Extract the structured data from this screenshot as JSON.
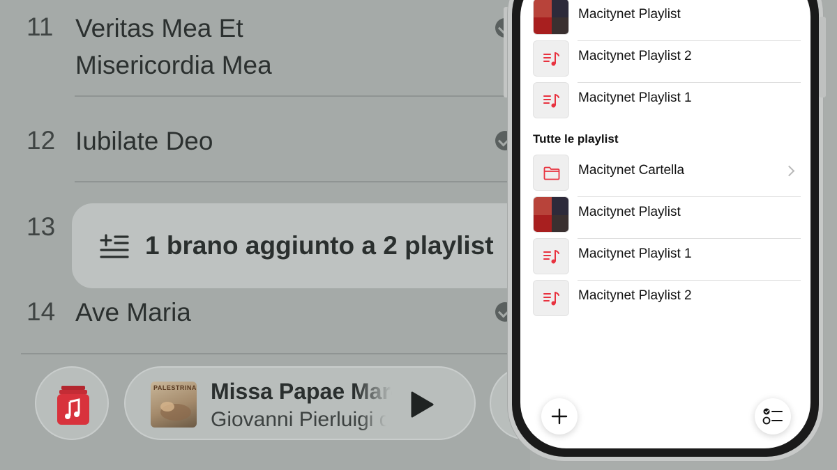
{
  "tracklist": {
    "items": [
      {
        "number": "11",
        "title_line1": "Veritas Mea Et",
        "title_line2": "Misericordia Mea"
      },
      {
        "number": "12",
        "title_line1": "Iubilate Deo"
      },
      {
        "number": "13"
      },
      {
        "number": "14",
        "title_line1": "Ave Maria"
      }
    ]
  },
  "toast": {
    "message": "1 brano aggiunto a 2 playlist",
    "icon": "add-to-list-icon"
  },
  "mini_player": {
    "app_icon": "music-app-icon",
    "artwork_label": "PALESTRINA",
    "song_title": "Missa Papae Marcelli",
    "artist": "Giovanni Pierluigi da Palestrina",
    "play_icon": "play-icon"
  },
  "phone": {
    "recent_playlists": [
      {
        "name": "Macitynet Playlist",
        "thumb": "collage"
      },
      {
        "name": "Macitynet Playlist 2",
        "thumb": "playlist-icon"
      },
      {
        "name": "Macitynet Playlist 1",
        "thumb": "playlist-icon"
      }
    ],
    "section_title": "Tutte le playlist",
    "all_playlists": [
      {
        "name": "Macitynet Cartella",
        "thumb": "folder-icon"
      },
      {
        "name": "Macitynet Playlist",
        "thumb": "collage"
      },
      {
        "name": "Macitynet Playlist 1",
        "thumb": "playlist-icon"
      },
      {
        "name": "Macitynet Playlist 2",
        "thumb": "playlist-icon"
      }
    ],
    "add_button_icon": "plus-icon",
    "select_button_icon": "checklist-icon"
  },
  "colors": {
    "accent": "#e8323f",
    "overlay_bg": "#a5aaa8",
    "toast_bg": "#bec2c1"
  }
}
